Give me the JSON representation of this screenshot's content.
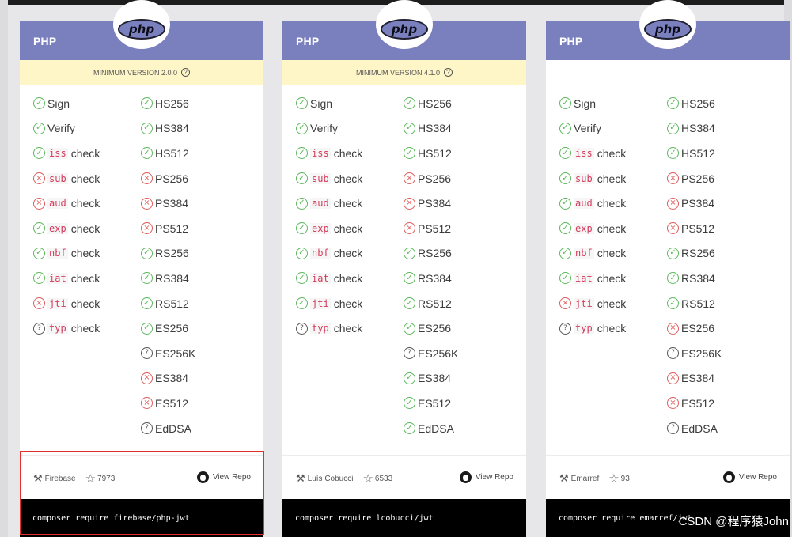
{
  "cards": [
    {
      "language": "PHP",
      "logo": "php",
      "min_version": "MINIMUM VERSION 2.0.0",
      "left_checks": [
        {
          "text": "Sign",
          "status": "ok"
        },
        {
          "text": "Verify",
          "status": "ok"
        },
        {
          "code": "iss",
          "text": "check",
          "status": "ok"
        },
        {
          "code": "sub",
          "text": "check",
          "status": "bad"
        },
        {
          "code": "aud",
          "text": "check",
          "status": "bad"
        },
        {
          "code": "exp",
          "text": "check",
          "status": "ok"
        },
        {
          "code": "nbf",
          "text": "check",
          "status": "ok"
        },
        {
          "code": "iat",
          "text": "check",
          "status": "ok"
        },
        {
          "code": "jti",
          "text": "check",
          "status": "bad"
        },
        {
          "code": "typ",
          "text": "check",
          "status": "unk"
        }
      ],
      "right_algs": [
        {
          "text": "HS256",
          "status": "ok"
        },
        {
          "text": "HS384",
          "status": "ok"
        },
        {
          "text": "HS512",
          "status": "ok"
        },
        {
          "text": "PS256",
          "status": "bad"
        },
        {
          "text": "PS384",
          "status": "bad"
        },
        {
          "text": "PS512",
          "status": "bad"
        },
        {
          "text": "RS256",
          "status": "ok"
        },
        {
          "text": "RS384",
          "status": "ok"
        },
        {
          "text": "RS512",
          "status": "ok"
        },
        {
          "text": "ES256",
          "status": "ok"
        },
        {
          "text": "ES256K",
          "status": "unk"
        },
        {
          "text": "ES384",
          "status": "bad"
        },
        {
          "text": "ES512",
          "status": "bad"
        },
        {
          "text": "EdDSA",
          "status": "unk"
        }
      ],
      "author": "Firebase",
      "stars": "7973",
      "view_repo": "View Repo",
      "command": "composer require firebase/php-jwt"
    },
    {
      "language": "PHP",
      "logo": "php",
      "min_version": "MINIMUM VERSION 4.1.0",
      "left_checks": [
        {
          "text": "Sign",
          "status": "ok"
        },
        {
          "text": "Verify",
          "status": "ok"
        },
        {
          "code": "iss",
          "text": "check",
          "status": "ok"
        },
        {
          "code": "sub",
          "text": "check",
          "status": "ok"
        },
        {
          "code": "aud",
          "text": "check",
          "status": "ok"
        },
        {
          "code": "exp",
          "text": "check",
          "status": "ok"
        },
        {
          "code": "nbf",
          "text": "check",
          "status": "ok"
        },
        {
          "code": "iat",
          "text": "check",
          "status": "ok"
        },
        {
          "code": "jti",
          "text": "check",
          "status": "ok"
        },
        {
          "code": "typ",
          "text": "check",
          "status": "unk"
        }
      ],
      "right_algs": [
        {
          "text": "HS256",
          "status": "ok"
        },
        {
          "text": "HS384",
          "status": "ok"
        },
        {
          "text": "HS512",
          "status": "ok"
        },
        {
          "text": "PS256",
          "status": "bad"
        },
        {
          "text": "PS384",
          "status": "bad"
        },
        {
          "text": "PS512",
          "status": "bad"
        },
        {
          "text": "RS256",
          "status": "ok"
        },
        {
          "text": "RS384",
          "status": "ok"
        },
        {
          "text": "RS512",
          "status": "ok"
        },
        {
          "text": "ES256",
          "status": "ok"
        },
        {
          "text": "ES256K",
          "status": "unk"
        },
        {
          "text": "ES384",
          "status": "ok"
        },
        {
          "text": "ES512",
          "status": "ok"
        },
        {
          "text": "EdDSA",
          "status": "ok"
        }
      ],
      "author": "Luís Cobucci",
      "stars": "6533",
      "view_repo": "View Repo",
      "command": "composer require lcobucci/jwt"
    },
    {
      "language": "PHP",
      "logo": "php",
      "min_version": "",
      "left_checks": [
        {
          "text": "Sign",
          "status": "ok"
        },
        {
          "text": "Verify",
          "status": "ok"
        },
        {
          "code": "iss",
          "text": "check",
          "status": "ok"
        },
        {
          "code": "sub",
          "text": "check",
          "status": "ok"
        },
        {
          "code": "aud",
          "text": "check",
          "status": "ok"
        },
        {
          "code": "exp",
          "text": "check",
          "status": "ok"
        },
        {
          "code": "nbf",
          "text": "check",
          "status": "ok"
        },
        {
          "code": "iat",
          "text": "check",
          "status": "ok"
        },
        {
          "code": "jti",
          "text": "check",
          "status": "bad"
        },
        {
          "code": "typ",
          "text": "check",
          "status": "unk"
        }
      ],
      "right_algs": [
        {
          "text": "HS256",
          "status": "ok"
        },
        {
          "text": "HS384",
          "status": "ok"
        },
        {
          "text": "HS512",
          "status": "ok"
        },
        {
          "text": "PS256",
          "status": "bad"
        },
        {
          "text": "PS384",
          "status": "bad"
        },
        {
          "text": "PS512",
          "status": "bad"
        },
        {
          "text": "RS256",
          "status": "ok"
        },
        {
          "text": "RS384",
          "status": "ok"
        },
        {
          "text": "RS512",
          "status": "ok"
        },
        {
          "text": "ES256",
          "status": "bad"
        },
        {
          "text": "ES256K",
          "status": "unk"
        },
        {
          "text": "ES384",
          "status": "bad"
        },
        {
          "text": "ES512",
          "status": "bad"
        },
        {
          "text": "EdDSA",
          "status": "unk"
        }
      ],
      "author": "Emarref",
      "stars": "93",
      "view_repo": "View Repo",
      "command": "composer require emarref/jwt"
    }
  ],
  "status_glyphs": {
    "ok": "✓",
    "bad": "×",
    "unk": "?"
  },
  "colors": {
    "header": "#7a7fbe",
    "ok": "#5cb85c",
    "bad": "#e05b5b",
    "unknown": "#555555",
    "code": "#d63a5b",
    "min_version_bg": "#fff6c8",
    "highlight": "#e03030"
  },
  "icons": {
    "author": "wrench-icon",
    "stars": "star-icon",
    "repo": "github-icon",
    "status": [
      "check-circle-icon",
      "x-circle-icon",
      "question-circle-icon"
    ]
  },
  "watermark": "CSDN @程序猿John"
}
